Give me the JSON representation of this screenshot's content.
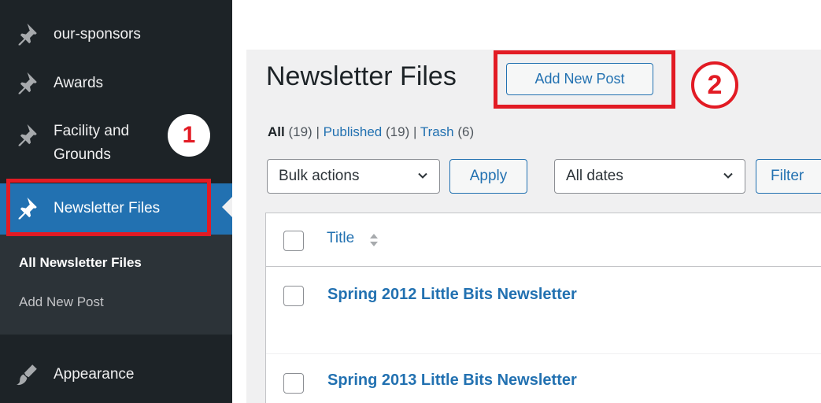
{
  "sidebar": {
    "items": [
      {
        "label": "our-sponsors"
      },
      {
        "label": "Awards"
      },
      {
        "label": "Facility and Grounds"
      },
      {
        "label": "Newsletter Files"
      },
      {
        "label": "Appearance"
      }
    ],
    "submenu": [
      {
        "label": "All Newsletter Files"
      },
      {
        "label": "Add New Post"
      }
    ]
  },
  "header": {
    "title": "Newsletter Files",
    "add_new_label": "Add New Post"
  },
  "filters": {
    "all_label": "All",
    "all_count": "(19)",
    "published_label": "Published",
    "published_count": "(19)",
    "trash_label": "Trash",
    "trash_count": "(6)",
    "separator": "|"
  },
  "toolbar": {
    "bulk_actions": "Bulk actions",
    "apply_label": "Apply",
    "dates": "All dates",
    "filter_label": "Filter"
  },
  "table": {
    "title_header": "Title",
    "rows": [
      {
        "title": "Spring 2012 Little Bits Newsletter"
      },
      {
        "title": "Spring 2013 Little Bits Newsletter"
      }
    ]
  },
  "annotations": {
    "step1": "1",
    "step2": "2",
    "color": "#e21b24"
  },
  "colors": {
    "sidebar_bg": "#1d2327",
    "accent": "#2271b1"
  }
}
